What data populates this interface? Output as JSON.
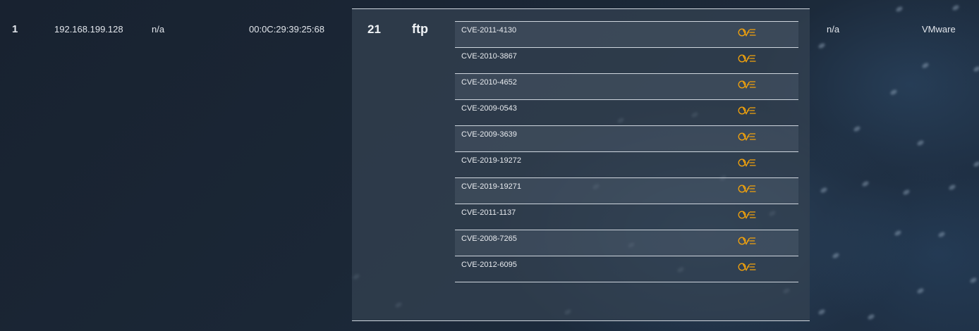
{
  "host_row": {
    "index": "1",
    "ip": "192.168.199.128",
    "hostname": "n/a",
    "mac": "00:0C:29:39:25:68",
    "os": "n/a",
    "vendor": "VMware"
  },
  "port": {
    "number": "21",
    "service": "ftp",
    "cve_icon": "cve-logo-icon",
    "cve_icon_color": "#f2a20c",
    "cves": [
      "CVE-2011-4130",
      "CVE-2010-3867",
      "CVE-2010-4652",
      "CVE-2009-0543",
      "CVE-2009-3639",
      "CVE-2019-19272",
      "CVE-2019-19271",
      "CVE-2011-1137",
      "CVE-2008-7265",
      "CVE-2012-6095"
    ]
  }
}
